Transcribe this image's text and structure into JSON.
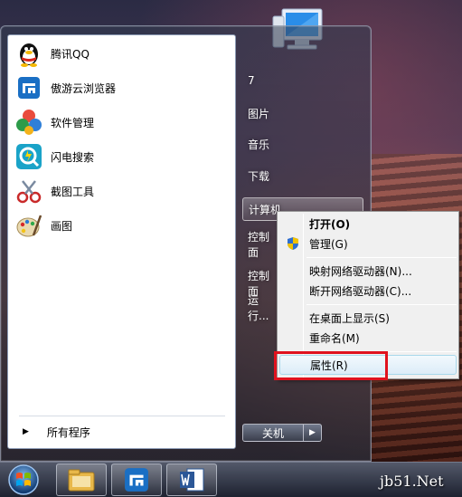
{
  "programs": [
    {
      "label": "腾讯QQ",
      "icon": "qq-penguin-icon"
    },
    {
      "label": "傲游云浏览器",
      "icon": "maxthon-browser-icon"
    },
    {
      "label": "软件管理",
      "icon": "software-manager-icon"
    },
    {
      "label": "闪电搜索",
      "icon": "lightning-search-icon"
    },
    {
      "label": "截图工具",
      "icon": "snipping-tool-icon"
    },
    {
      "label": "画图",
      "icon": "paint-palette-icon"
    }
  ],
  "all_programs": "所有程序",
  "right_pane": {
    "items": [
      "7",
      "图片",
      "音乐",
      "下载",
      "计算机",
      "控制面",
      "控制面",
      "运行..."
    ]
  },
  "shutdown_label": "关机",
  "context_menu": {
    "open": "打开(O)",
    "manage": "管理(G)",
    "map_drive": "映射网络驱动器(N)...",
    "disconnect_drive": "断开网络驱动器(C)...",
    "show_desktop": "在桌面上显示(S)",
    "rename": "重命名(M)",
    "properties": "属性(R)"
  },
  "taskbar": {
    "apps": [
      "file-explorer-icon",
      "maxthon-browser-icon",
      "word-icon"
    ]
  },
  "watermark": {
    "text": "jb51.Net"
  },
  "colors": {
    "highlight_box": "#e0121e",
    "maxthon_blue": "#1a6fc4",
    "word_blue": "#2b5797"
  }
}
